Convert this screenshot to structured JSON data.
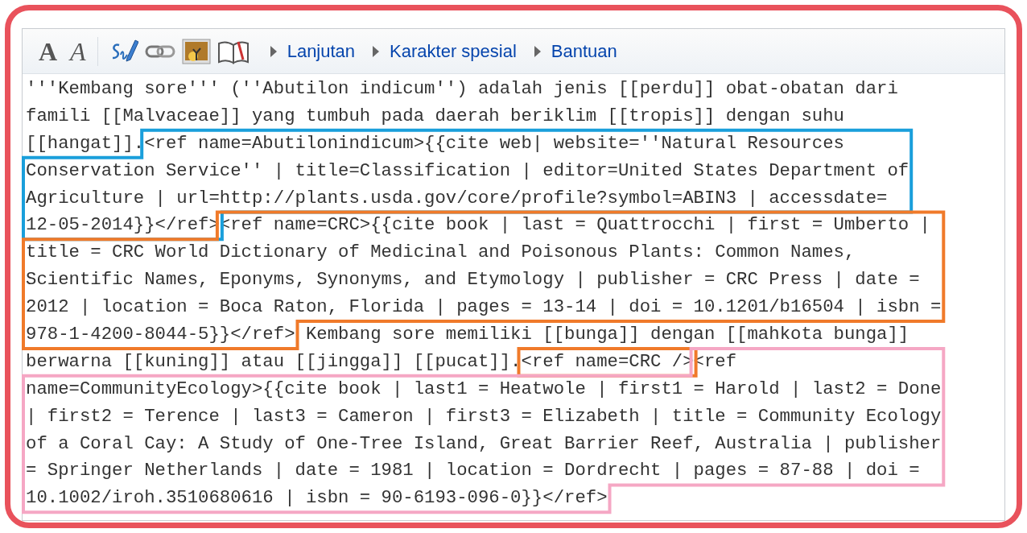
{
  "toolbar": {
    "format_buttons": [
      {
        "kind": "bold",
        "label": "A"
      },
      {
        "kind": "italic",
        "label": "A"
      }
    ],
    "insert_buttons": [
      {
        "kind": "signature"
      },
      {
        "kind": "link"
      },
      {
        "kind": "image"
      },
      {
        "kind": "reference"
      }
    ],
    "menus": [
      {
        "label": "Lanjutan",
        "expanded": false
      },
      {
        "label": "Karakter spesial",
        "expanded": false
      },
      {
        "label": "Bantuan",
        "expanded": false
      }
    ]
  },
  "editor": {
    "runs": [
      {
        "lines": [
          "'''Kembang sore''' (''Abutilon indicum'') adalah jenis [[perdu]] obat-obatan dari",
          "famili [[Malvaceae]] yang tumbuh pada daerah beriklim [[tropis]] dengan suhu",
          "[[hangat]]."
        ]
      },
      {
        "color": "#1a9fdb",
        "lines": [
          "<ref name=Abutilonindicum>{{cite web| website=''Natural Resources",
          "Conservation Service'' | title=Classification | editor=United States Department of",
          "Agriculture | url=http://plants.usda.gov/core/profile?symbol=ABIN3 | accessdate=",
          "12-05-2014}}</ref>"
        ]
      },
      {
        "color": "#f07a2a",
        "lines": [
          "<ref name=CRC>{{cite book | last = Quattrocchi | first = Umberto |",
          "title = CRC World Dictionary of Medicinal and Poisonous Plants: Common Names,",
          "Scientific Names, Eponyms, Synonyms, and Etymology | publisher = CRC Press | date =",
          "2012 | location = Boca Raton, Florida | pages = 13-14 | doi = 10.1201/b16504 | isbn =",
          "978-1-4200-8044-5}}</ref>"
        ]
      },
      {
        "lines": [
          " Kembang sore memiliki [[bunga]] dengan [[mahkota bunga]]",
          "berwarna [[kuning]] atau [[jingga]] [[pucat]]."
        ]
      },
      {
        "color": "#f07a2a",
        "lines": [
          "<ref name=CRC />"
        ]
      },
      {
        "color": "#f5a7c4",
        "lines": [
          "<ref",
          "name=CommunityEcology>{{cite book | last1 = Heatwole | first1 = Harold | last2 = Done",
          "| first2 = Terence | last3 = Cameron | first3 = Elizabeth | title = Community Ecology",
          "of a Coral Cay: A Study of One-Tree Island, Great Barrier Reef, Australia | publisher",
          "= Springer Netherlands | date = 1981 | location = Dordrecht | pages = 87-88 | doi =",
          "10.1002/iroh.3510680616 | isbn = 90-6193-096-0}}</ref>"
        ]
      }
    ]
  }
}
